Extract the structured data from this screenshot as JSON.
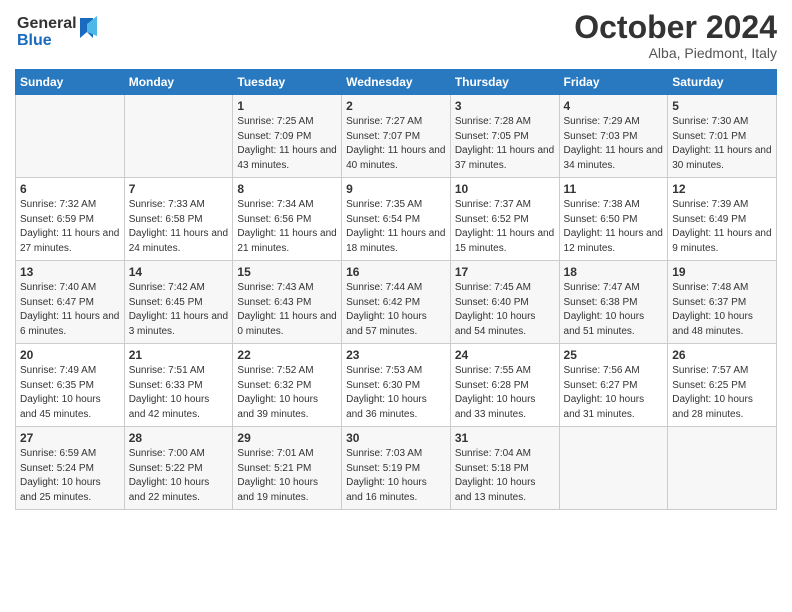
{
  "header": {
    "logo_line1": "General",
    "logo_line2": "Blue",
    "month_title": "October 2024",
    "subtitle": "Alba, Piedmont, Italy"
  },
  "weekdays": [
    "Sunday",
    "Monday",
    "Tuesday",
    "Wednesday",
    "Thursday",
    "Friday",
    "Saturday"
  ],
  "weeks": [
    [
      {
        "day": "",
        "sunrise": "",
        "sunset": "",
        "daylight": ""
      },
      {
        "day": "",
        "sunrise": "",
        "sunset": "",
        "daylight": ""
      },
      {
        "day": "1",
        "sunrise": "Sunrise: 7:25 AM",
        "sunset": "Sunset: 7:09 PM",
        "daylight": "Daylight: 11 hours and 43 minutes."
      },
      {
        "day": "2",
        "sunrise": "Sunrise: 7:27 AM",
        "sunset": "Sunset: 7:07 PM",
        "daylight": "Daylight: 11 hours and 40 minutes."
      },
      {
        "day": "3",
        "sunrise": "Sunrise: 7:28 AM",
        "sunset": "Sunset: 7:05 PM",
        "daylight": "Daylight: 11 hours and 37 minutes."
      },
      {
        "day": "4",
        "sunrise": "Sunrise: 7:29 AM",
        "sunset": "Sunset: 7:03 PM",
        "daylight": "Daylight: 11 hours and 34 minutes."
      },
      {
        "day": "5",
        "sunrise": "Sunrise: 7:30 AM",
        "sunset": "Sunset: 7:01 PM",
        "daylight": "Daylight: 11 hours and 30 minutes."
      }
    ],
    [
      {
        "day": "6",
        "sunrise": "Sunrise: 7:32 AM",
        "sunset": "Sunset: 6:59 PM",
        "daylight": "Daylight: 11 hours and 27 minutes."
      },
      {
        "day": "7",
        "sunrise": "Sunrise: 7:33 AM",
        "sunset": "Sunset: 6:58 PM",
        "daylight": "Daylight: 11 hours and 24 minutes."
      },
      {
        "day": "8",
        "sunrise": "Sunrise: 7:34 AM",
        "sunset": "Sunset: 6:56 PM",
        "daylight": "Daylight: 11 hours and 21 minutes."
      },
      {
        "day": "9",
        "sunrise": "Sunrise: 7:35 AM",
        "sunset": "Sunset: 6:54 PM",
        "daylight": "Daylight: 11 hours and 18 minutes."
      },
      {
        "day": "10",
        "sunrise": "Sunrise: 7:37 AM",
        "sunset": "Sunset: 6:52 PM",
        "daylight": "Daylight: 11 hours and 15 minutes."
      },
      {
        "day": "11",
        "sunrise": "Sunrise: 7:38 AM",
        "sunset": "Sunset: 6:50 PM",
        "daylight": "Daylight: 11 hours and 12 minutes."
      },
      {
        "day": "12",
        "sunrise": "Sunrise: 7:39 AM",
        "sunset": "Sunset: 6:49 PM",
        "daylight": "Daylight: 11 hours and 9 minutes."
      }
    ],
    [
      {
        "day": "13",
        "sunrise": "Sunrise: 7:40 AM",
        "sunset": "Sunset: 6:47 PM",
        "daylight": "Daylight: 11 hours and 6 minutes."
      },
      {
        "day": "14",
        "sunrise": "Sunrise: 7:42 AM",
        "sunset": "Sunset: 6:45 PM",
        "daylight": "Daylight: 11 hours and 3 minutes."
      },
      {
        "day": "15",
        "sunrise": "Sunrise: 7:43 AM",
        "sunset": "Sunset: 6:43 PM",
        "daylight": "Daylight: 11 hours and 0 minutes."
      },
      {
        "day": "16",
        "sunrise": "Sunrise: 7:44 AM",
        "sunset": "Sunset: 6:42 PM",
        "daylight": "Daylight: 10 hours and 57 minutes."
      },
      {
        "day": "17",
        "sunrise": "Sunrise: 7:45 AM",
        "sunset": "Sunset: 6:40 PM",
        "daylight": "Daylight: 10 hours and 54 minutes."
      },
      {
        "day": "18",
        "sunrise": "Sunrise: 7:47 AM",
        "sunset": "Sunset: 6:38 PM",
        "daylight": "Daylight: 10 hours and 51 minutes."
      },
      {
        "day": "19",
        "sunrise": "Sunrise: 7:48 AM",
        "sunset": "Sunset: 6:37 PM",
        "daylight": "Daylight: 10 hours and 48 minutes."
      }
    ],
    [
      {
        "day": "20",
        "sunrise": "Sunrise: 7:49 AM",
        "sunset": "Sunset: 6:35 PM",
        "daylight": "Daylight: 10 hours and 45 minutes."
      },
      {
        "day": "21",
        "sunrise": "Sunrise: 7:51 AM",
        "sunset": "Sunset: 6:33 PM",
        "daylight": "Daylight: 10 hours and 42 minutes."
      },
      {
        "day": "22",
        "sunrise": "Sunrise: 7:52 AM",
        "sunset": "Sunset: 6:32 PM",
        "daylight": "Daylight: 10 hours and 39 minutes."
      },
      {
        "day": "23",
        "sunrise": "Sunrise: 7:53 AM",
        "sunset": "Sunset: 6:30 PM",
        "daylight": "Daylight: 10 hours and 36 minutes."
      },
      {
        "day": "24",
        "sunrise": "Sunrise: 7:55 AM",
        "sunset": "Sunset: 6:28 PM",
        "daylight": "Daylight: 10 hours and 33 minutes."
      },
      {
        "day": "25",
        "sunrise": "Sunrise: 7:56 AM",
        "sunset": "Sunset: 6:27 PM",
        "daylight": "Daylight: 10 hours and 31 minutes."
      },
      {
        "day": "26",
        "sunrise": "Sunrise: 7:57 AM",
        "sunset": "Sunset: 6:25 PM",
        "daylight": "Daylight: 10 hours and 28 minutes."
      }
    ],
    [
      {
        "day": "27",
        "sunrise": "Sunrise: 6:59 AM",
        "sunset": "Sunset: 5:24 PM",
        "daylight": "Daylight: 10 hours and 25 minutes."
      },
      {
        "day": "28",
        "sunrise": "Sunrise: 7:00 AM",
        "sunset": "Sunset: 5:22 PM",
        "daylight": "Daylight: 10 hours and 22 minutes."
      },
      {
        "day": "29",
        "sunrise": "Sunrise: 7:01 AM",
        "sunset": "Sunset: 5:21 PM",
        "daylight": "Daylight: 10 hours and 19 minutes."
      },
      {
        "day": "30",
        "sunrise": "Sunrise: 7:03 AM",
        "sunset": "Sunset: 5:19 PM",
        "daylight": "Daylight: 10 hours and 16 minutes."
      },
      {
        "day": "31",
        "sunrise": "Sunrise: 7:04 AM",
        "sunset": "Sunset: 5:18 PM",
        "daylight": "Daylight: 10 hours and 13 minutes."
      },
      {
        "day": "",
        "sunrise": "",
        "sunset": "",
        "daylight": ""
      },
      {
        "day": "",
        "sunrise": "",
        "sunset": "",
        "daylight": ""
      }
    ]
  ]
}
